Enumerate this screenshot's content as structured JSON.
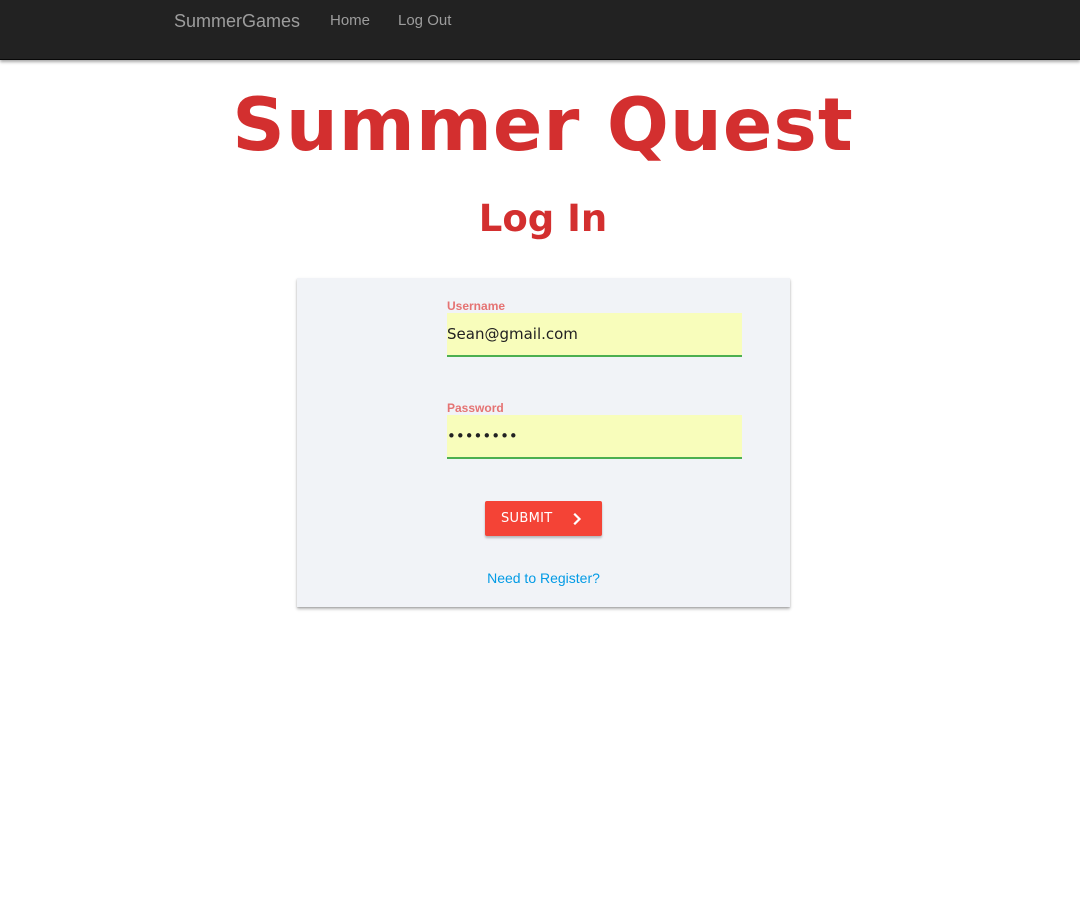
{
  "navbar": {
    "brand": "SummerGames",
    "links": [
      {
        "label": "Home"
      },
      {
        "label": "Log Out"
      }
    ]
  },
  "main": {
    "title": "Summer Quest",
    "subtitle": "Log In"
  },
  "form": {
    "username": {
      "label": "Username",
      "value": "Sean@gmail.com"
    },
    "password": {
      "label": "Password",
      "value": "••••••••"
    },
    "submit": {
      "label": "SUBMIT",
      "icon": "chevron-right-icon"
    },
    "register_link": "Need to Register?"
  },
  "colors": {
    "navbar_bg": "#222222",
    "title": "#d32f2f",
    "label": "#e57373",
    "input_bg": "#f8fdbb",
    "input_underline": "#4caf50",
    "button": "#f44336",
    "link": "#039be5",
    "card_bg": "#f1f3f7"
  }
}
